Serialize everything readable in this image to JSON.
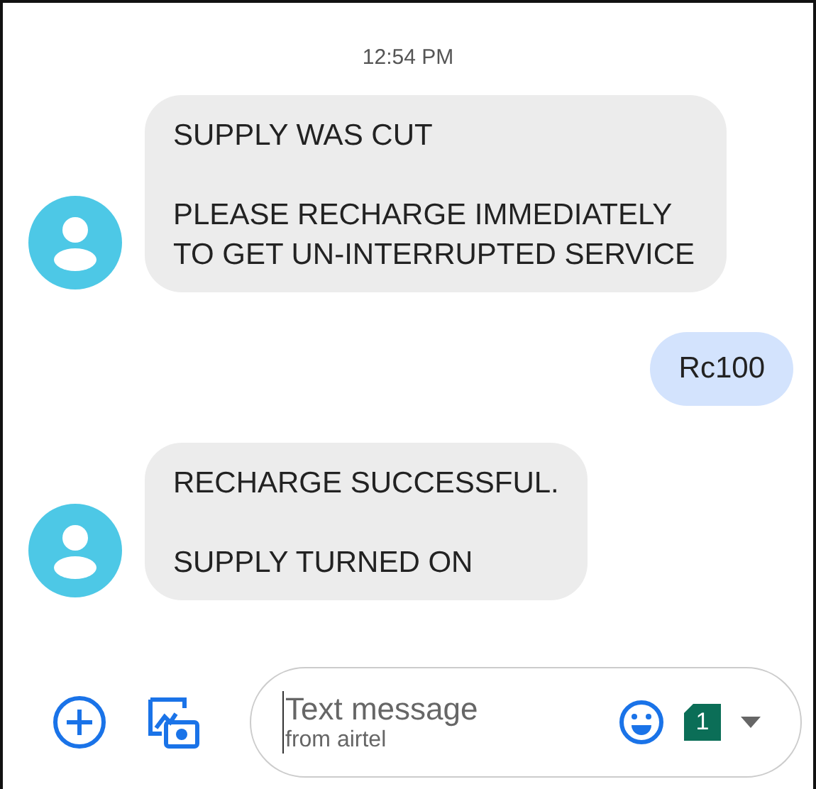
{
  "timestamp": "12:54 PM",
  "messages": [
    {
      "kind": "incoming",
      "paragraphs": [
        "SUPPLY WAS CUT",
        "PLEASE RECHARGE IMMEDIATELY TO GET UN-INTERRUPTED SERVICE"
      ]
    },
    {
      "kind": "outgoing",
      "paragraphs": [
        "Rc100"
      ]
    },
    {
      "kind": "incoming",
      "paragraphs": [
        "RECHARGE SUCCESSFUL.",
        "SUPPLY TURNED ON"
      ]
    }
  ],
  "composer": {
    "placeholder": "Text message",
    "subtitle": "from airtel",
    "sim": "1"
  }
}
